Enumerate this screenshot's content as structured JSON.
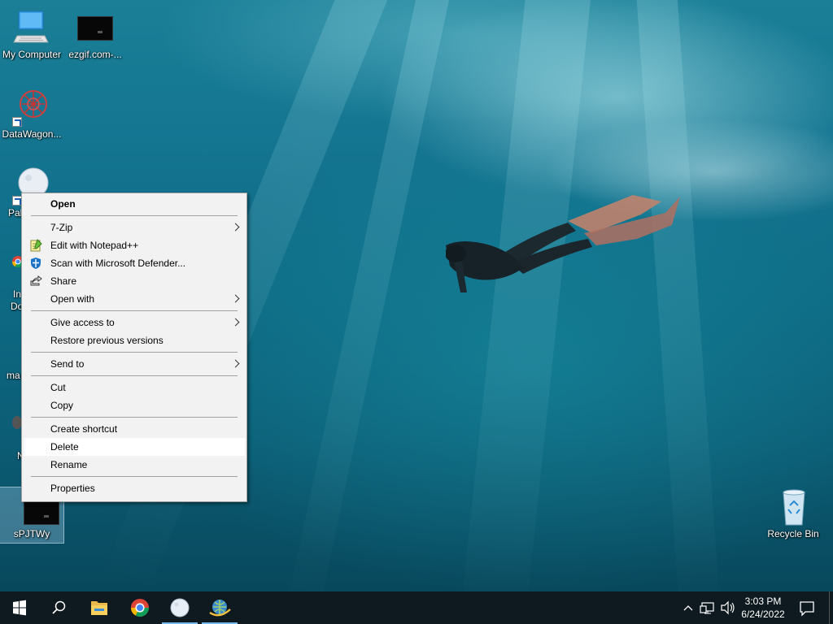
{
  "desktop": {
    "icons": [
      {
        "label": "My Computer"
      },
      {
        "label": "ezgif.com-..."
      },
      {
        "label": "DataWagon..."
      },
      {
        "label": "Pal"
      },
      {
        "label": "In"
      },
      {
        "label": "Do"
      },
      {
        "label": "ma"
      },
      {
        "label": "N"
      },
      {
        "label": "sPJTWy"
      },
      {
        "label": "Recycle Bin"
      }
    ]
  },
  "context_menu": {
    "items": [
      {
        "label": "Open"
      },
      {
        "label": "7-Zip"
      },
      {
        "label": "Edit with Notepad++",
        "icon": "notepad-plus-icon"
      },
      {
        "label": "Scan with Microsoft Defender...",
        "icon": "defender-shield-icon"
      },
      {
        "label": "Share",
        "icon": "share-icon"
      },
      {
        "label": "Open with"
      },
      {
        "label": "Give access to"
      },
      {
        "label": "Restore previous versions"
      },
      {
        "label": "Send to"
      },
      {
        "label": "Cut"
      },
      {
        "label": "Copy"
      },
      {
        "label": "Create shortcut"
      },
      {
        "label": "Delete"
      },
      {
        "label": "Rename"
      },
      {
        "label": "Properties"
      }
    ],
    "hovered": "Delete"
  },
  "taskbar": {
    "pinned": [
      "start-icon",
      "search-icon",
      "file-explorer-icon",
      "chrome-icon",
      "pale-moon-icon",
      "network-tool-icon"
    ],
    "clock": {
      "time": "3:03 PM",
      "date": "6/24/2022"
    },
    "colors": {
      "accent": "#76b9ed",
      "background": "#0f1a20"
    }
  }
}
